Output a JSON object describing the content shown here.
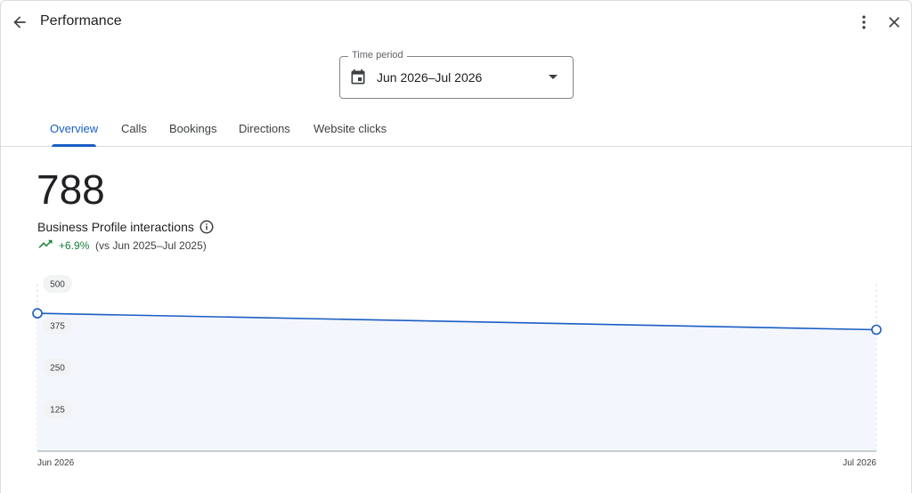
{
  "header": {
    "title": "Performance",
    "icons": {
      "back": "arrow-back-icon",
      "more": "more-vert-icon",
      "close": "close-icon"
    }
  },
  "time_period": {
    "label": "Time period",
    "value": "Jun 2026–Jul 2026"
  },
  "tabs": [
    {
      "label": "Overview",
      "active": true
    },
    {
      "label": "Calls",
      "active": false
    },
    {
      "label": "Bookings",
      "active": false
    },
    {
      "label": "Directions",
      "active": false
    },
    {
      "label": "Website clicks",
      "active": false
    }
  ],
  "metric": {
    "value": "788",
    "label": "Business Profile interactions",
    "change": "+6.9%",
    "comparison": "(vs Jun 2025–Jul 2025)"
  },
  "colors": {
    "accent": "#1a5dc5",
    "positive": "#188038",
    "area_fill": "#f3f6fd"
  },
  "chart_data": {
    "type": "area",
    "x": [
      "Jun 2026",
      "Jul 2026"
    ],
    "series": [
      {
        "values": [
          412,
          363
        ]
      }
    ],
    "yticks": [
      125,
      250,
      375,
      500
    ],
    "ylim": [
      0,
      500
    ],
    "grid": false,
    "legend": "none"
  }
}
